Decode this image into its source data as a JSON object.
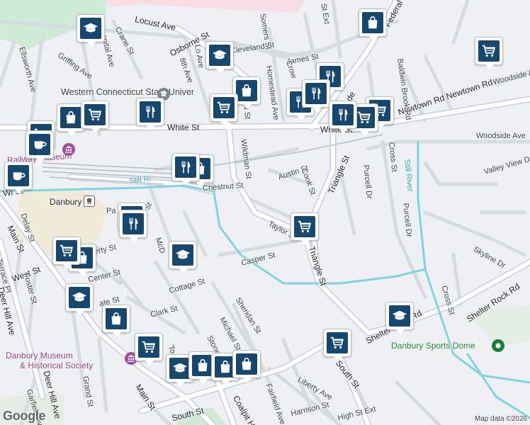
{
  "map": {
    "attribution": "Google",
    "credit": "Map data ©2026",
    "colors": {
      "background": "#eef0f3",
      "road": "#ffffff",
      "road_outline": "#c9ced6",
      "river": "#7fd3e3",
      "park": "#cfead5",
      "pin": "#16476e"
    },
    "roads": {
      "locust_ave": "Locust Ave",
      "osborne_st": "Osborne St",
      "cleveland_st": "Cleveland St",
      "james_st": "James St",
      "crane_st": "Crane St",
      "hospital_ave": "Hospital Ave",
      "griffing_ave": "Griffing Ave",
      "ellsworth_ave": "Ellsworth Ave",
      "eighth_ave": "8th Ave",
      "lo_ave": "Lo Ave",
      "somers_st": "Somers St",
      "homestead_ave": "Homestead Ave",
      "crow": "Crow",
      "st_ext": "St Ext",
      "federal_rd": "Federal Rd",
      "fede": "Fede",
      "white_st": "White St",
      "white_st_right": "White St",
      "wildman_st": "Wildman St",
      "adow_st": "adow St",
      "chestnut_st": "Chestnut St",
      "austin_st": "Austin St",
      "cook_st": "Cook St",
      "triangle_st": "Triangle St",
      "triangle_st_lower": "Triangle St",
      "purcell_dr": "Purcell Dr",
      "purcell_dr_2": "Purcell Dr",
      "cross_st": "Cross St",
      "cross_st_2": "Cross St",
      "newtown_rd": "Newtown Rd Newtown Rd",
      "woodside_ave": "Woodside Ave",
      "woodside_ave_2": "Woodside Ave",
      "valley_view": "Valley View D",
      "skyline_dr": "Skyline Dr",
      "shelter_rock_rd": "Shelter Rock Rd",
      "shelter_rock_rd_2": "Shelter Rock Rd",
      "baldwin_brook_rd": "Baldwin Brook Rd",
      "taylor_st": "Taylor St",
      "casper_st": "Casper St",
      "sheridan_st": "Sheridan St",
      "michael_st": "Michael St",
      "stone_st": "Stone St",
      "liberty_ave": "Liberty Ave",
      "harrison_st": "Harrison St",
      "fairfield_ave": "Fairfield Ave",
      "south_st": "South St",
      "south_st_lower": "South St",
      "high_st_ext": "High St Ext",
      "coalpit_hill": "Coalpit Hi",
      "main_st": "Main St",
      "main_st_lower": "Main St",
      "west_st": "West St",
      "deer_hill_ave": "Deer Hill Ave",
      "deer_hill_ave_2": "Deer Hill Ave",
      "foster_st": "Foster St",
      "delay_st": "Delay St",
      "terrace_pl": "Terrace Pl",
      "grand_st": "Grand St",
      "garfield_ave": "Garfield Ave",
      "e_liberty_st": "E Liberty St",
      "liberty_st": "Liberty St",
      "center_st": "Center St",
      "cottage_st": "Cottage St",
      "clark_st": "Clark St",
      "ate_st": "ate St",
      "mcd": "McD",
      "pa": "Pa",
      "to": "To",
      "wi_st": "Wi St",
      "sh_ave": "S Ave",
      "nroad_rd": "Road",
      "beaver_brook": "Brook Rd"
    },
    "places": {
      "wcsu": "Western Connecticut State Univer",
      "danbury_museum_line1": "Danbury Museum",
      "danbury_museum_line2": "& Historical Society",
      "danbury": "Danbury",
      "danbury_sports_dome": "Danbury Sports Dome",
      "railway_museum": "Railway Museum",
      "still_river": "Still River",
      "still_river_2": "Still Ri"
    }
  }
}
